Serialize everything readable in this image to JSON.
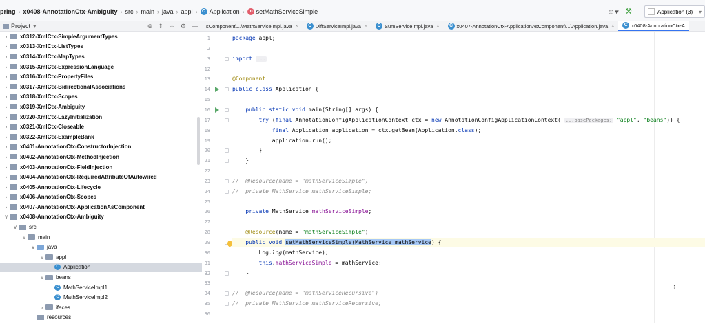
{
  "breadcrumb": {
    "items": [
      "pring",
      "x0408-AnnotationCtx-Ambiguity",
      "src",
      "main",
      "java",
      "appl",
      "Application",
      "setMathServiceSimple"
    ]
  },
  "toolbar": {
    "run_config": "Application (3)",
    "user_icon": "user-icon",
    "build_icon": "hammer-icon"
  },
  "project_panel": {
    "title": "Project",
    "tree": [
      {
        "label": "x0312-XmlCtx-SimpleArgumentTypes",
        "level": 1,
        "type": "module",
        "expanded": false
      },
      {
        "label": "x0313-XmlCtx-ListTypes",
        "level": 1,
        "type": "module",
        "expanded": false
      },
      {
        "label": "x0314-XmlCtx-MapTypes",
        "level": 1,
        "type": "module",
        "expanded": false
      },
      {
        "label": "x0315-XmlCtx-ExpressionLanguage",
        "level": 1,
        "type": "module",
        "expanded": false
      },
      {
        "label": "x0316-XmlCtx-PropertyFiles",
        "level": 1,
        "type": "module",
        "expanded": false
      },
      {
        "label": "x0317-XmlCtx-BidirectionalAssociations",
        "level": 1,
        "type": "module",
        "expanded": false
      },
      {
        "label": "x0318-XmlCtx-Scopes",
        "level": 1,
        "type": "module",
        "expanded": false
      },
      {
        "label": "x0319-XmlCtx-Ambiguity",
        "level": 1,
        "type": "module",
        "expanded": false
      },
      {
        "label": "x0320-XmlCtx-LazyInitialization",
        "level": 1,
        "type": "module",
        "expanded": false
      },
      {
        "label": "x0321-XmlCtx-Closeable",
        "level": 1,
        "type": "module",
        "expanded": false
      },
      {
        "label": "x0322-XmlCtx-ExampleBank",
        "level": 1,
        "type": "module",
        "expanded": false
      },
      {
        "label": "x0401-AnnotationCtx-ConstructorInjection",
        "level": 1,
        "type": "module",
        "expanded": false
      },
      {
        "label": "x0402-AnnotationCtx-MethodInjection",
        "level": 1,
        "type": "module",
        "expanded": false
      },
      {
        "label": "x0403-AnnotationCtx-FieldInjection",
        "level": 1,
        "type": "module",
        "expanded": false
      },
      {
        "label": "x0404-AnnotationCtx-RequiredAttributeOfAutowired",
        "level": 1,
        "type": "module",
        "expanded": false
      },
      {
        "label": "x0405-AnnotationCtx-Lifecycle",
        "level": 1,
        "type": "module",
        "expanded": false
      },
      {
        "label": "x0406-AnnotationCtx-Scopes",
        "level": 1,
        "type": "module",
        "expanded": false
      },
      {
        "label": "x0407-AnnotationCtx-ApplicationAsComponent",
        "level": 1,
        "type": "module",
        "expanded": false
      },
      {
        "label": "x0408-AnnotationCtx-Ambiguity",
        "level": 1,
        "type": "module",
        "expanded": true
      },
      {
        "label": "src",
        "level": 2,
        "type": "folder",
        "expanded": true
      },
      {
        "label": "main",
        "level": 3,
        "type": "folder",
        "expanded": true
      },
      {
        "label": "java",
        "level": 4,
        "type": "folder-blue",
        "expanded": true
      },
      {
        "label": "appl",
        "level": 5,
        "type": "package",
        "expanded": true
      },
      {
        "label": "Application",
        "level": 6,
        "type": "class",
        "selected": true
      },
      {
        "label": "beans",
        "level": 5,
        "type": "package",
        "expanded": true
      },
      {
        "label": "MathServiceImpl1",
        "level": 6,
        "type": "class"
      },
      {
        "label": "MathServiceImpl2",
        "level": 6,
        "type": "class"
      },
      {
        "label": "ifaces",
        "level": 5,
        "type": "package",
        "expanded": false
      },
      {
        "label": "resources",
        "level": 4,
        "type": "folder",
        "expanded": null
      }
    ]
  },
  "editor_tabs": [
    {
      "label": "sComponent\\...\\MathServiceImpl.java",
      "active": false
    },
    {
      "label": "DiffServiceImpl.java",
      "active": false
    },
    {
      "label": "SumServiceImpl.java",
      "active": false
    },
    {
      "label": "x0407-AnnotationCtx-ApplicationAsComponent\\...\\Application.java",
      "active": false
    },
    {
      "label": "x0408-AnnotationCtx-A",
      "active": true
    }
  ],
  "editor": {
    "lines": [
      {
        "n": "1",
        "html": "<span class='kw'>package</span> appl;"
      },
      {
        "n": "2",
        "html": ""
      },
      {
        "n": "3",
        "html": "<span class='kw'>import</span> <span class='hint'>...</span>"
      },
      {
        "n": "12",
        "html": ""
      },
      {
        "n": "13",
        "html": "<span class='an'>@Component</span>"
      },
      {
        "n": "14",
        "html": "<span class='kw'>public class</span> Application {",
        "run": true
      },
      {
        "n": "15",
        "html": ""
      },
      {
        "n": "16",
        "html": "    <span class='kw'>public static void</span> main(String[] args) {",
        "run": true
      },
      {
        "n": "17",
        "html": "        <span class='kw'>try</span> (<span class='kw'>final</span> AnnotationConfigApplicationContext ctx = <span class='kw'>new</span> AnnotationConfigApplicationContext( <span class='hint'>...basePackages:</span> <span class='st'>\"appl\"</span>, <span class='st'>\"beans\"</span>)) {"
      },
      {
        "n": "18",
        "html": "            <span class='kw'>final</span> Application application = ctx.getBean(Application.<span class='kw'>class</span>);"
      },
      {
        "n": "19",
        "html": "            application.run();"
      },
      {
        "n": "20",
        "html": "        }"
      },
      {
        "n": "21",
        "html": "    }"
      },
      {
        "n": "22",
        "html": ""
      },
      {
        "n": "23",
        "html": "<span class='cm'>//  @Resource(name = \"mathServiceSimple\")</span>"
      },
      {
        "n": "24",
        "html": "<span class='cm'>//  private MathService mathServiceSimple;</span>"
      },
      {
        "n": "25",
        "html": ""
      },
      {
        "n": "26",
        "html": "    <span class='kw'>private</span> MathService <span class='fld'>mathServiceSimple</span>;"
      },
      {
        "n": "27",
        "html": ""
      },
      {
        "n": "28",
        "html": "    <span class='an'>@Resource</span>(name = <span class='st'>\"mathServiceSimple\"</span>)"
      },
      {
        "n": "29",
        "html": "    <span class='kw'>public void</span> <span class='sel-text'>setMathServiceSimple(MathService mathService</span>) {",
        "current": true
      },
      {
        "n": "30",
        "html": "        Log.<span style='font-style:italic'>log</span>(mathService);"
      },
      {
        "n": "31",
        "html": "        <span class='kw'>this</span>.<span class='fld'>mathServiceSimple</span> = mathService;"
      },
      {
        "n": "32",
        "html": "    }"
      },
      {
        "n": "33",
        "html": ""
      },
      {
        "n": "34",
        "html": "<span class='cm'>//  @Resource(name = \"mathServiceRecursive\")</span>"
      },
      {
        "n": "35",
        "html": "<span class='cm'>//  private MathService mathServiceRecursive;</span>"
      },
      {
        "n": "36",
        "html": ""
      }
    ]
  },
  "colors": {
    "accent": "#3574f0",
    "selection": "#a6c8f5",
    "tree_selected": "#d5d9e0"
  }
}
